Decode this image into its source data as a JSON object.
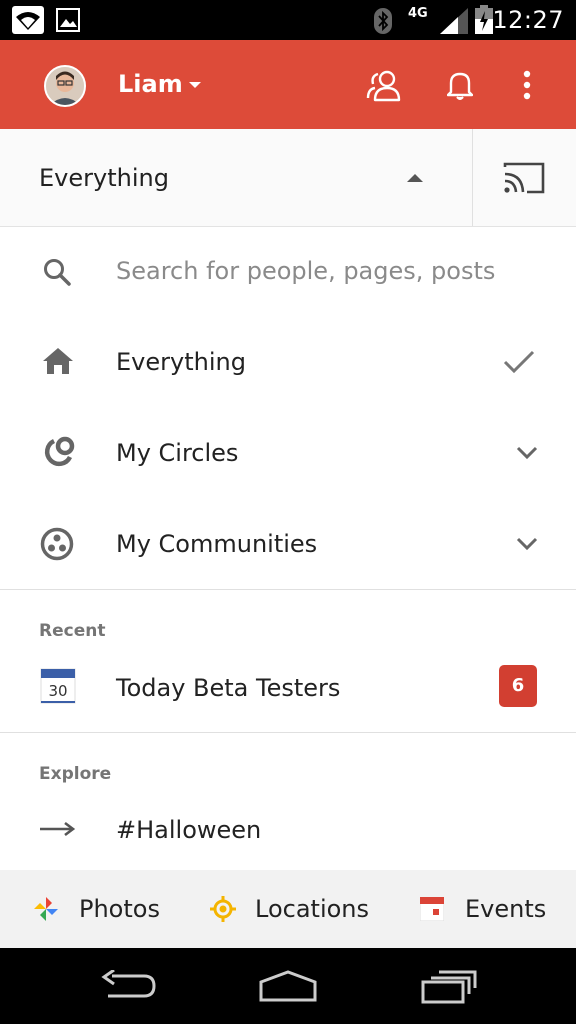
{
  "status_bar": {
    "time": "12:27",
    "network": "4G"
  },
  "header": {
    "account_name": "Liam"
  },
  "stream_selector": {
    "selected": "Everything"
  },
  "menu": {
    "search_placeholder": "Search for people, pages, posts",
    "items": [
      {
        "label": "Everything",
        "icon": "home-icon",
        "trailing": "check-icon"
      },
      {
        "label": "My Circles",
        "icon": "circles-icon",
        "trailing": "chevron-down-icon"
      },
      {
        "label": "My Communities",
        "icon": "communities-icon",
        "trailing": "chevron-down-icon"
      }
    ]
  },
  "recent": {
    "title": "Recent",
    "items": [
      {
        "label": "Today Beta Testers",
        "calendar_day": "30",
        "badge": "6"
      }
    ]
  },
  "explore": {
    "title": "Explore",
    "items": [
      {
        "label": "#Halloween"
      }
    ]
  },
  "bottom_tabs": [
    {
      "label": "Photos",
      "icon": "photos-icon"
    },
    {
      "label": "Locations",
      "icon": "locations-icon"
    },
    {
      "label": "Events",
      "icon": "events-icon"
    }
  ],
  "colors": {
    "appbar": "#dd4b39",
    "badge": "#d23f31"
  }
}
